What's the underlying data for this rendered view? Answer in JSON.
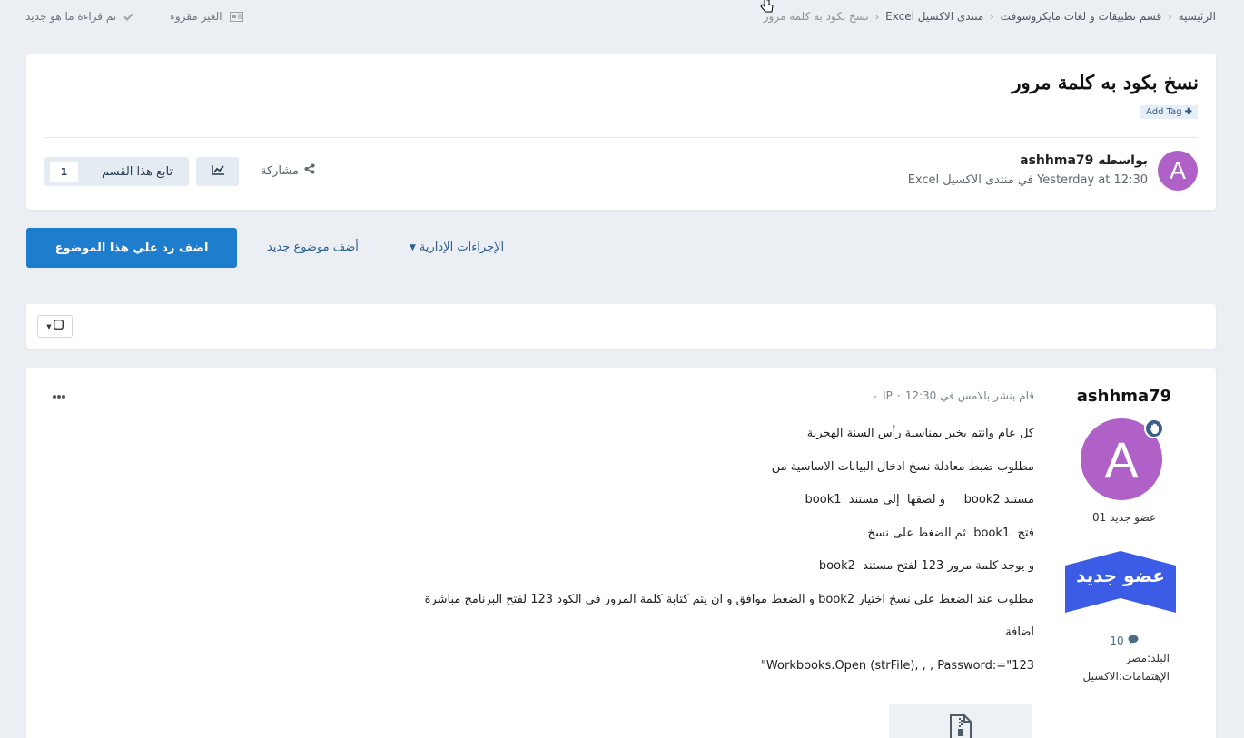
{
  "breadcrumb": {
    "items": [
      "الرئيسيه",
      "قسم تطبيقات و لغات مايكروسوفت",
      "منتدى الاكسيل Excel"
    ],
    "current": "نسخ بكود به كلمة مرور"
  },
  "top_actions": {
    "unread": "الغير مقروء",
    "mark_read": "تم قراءة ما هو جديد"
  },
  "topic": {
    "title": "نسخ بكود به كلمة مرور",
    "add_tag": "Add Tag",
    "author_line": "بواسطه ashhma79",
    "meta_line": "Yesterday at 12:30 في منتدى الاكسيل Excel",
    "avatar_letter": "A",
    "share_label": "مشاركة",
    "follow_label": "تابع هذا القسم",
    "follow_count": "1"
  },
  "actions": {
    "reply": "اضف رد علي هذا الموضوع",
    "new_topic": "أضف موضوع جديد",
    "moderation": "الإجراءات الإدارية"
  },
  "post": {
    "author": "ashhma79",
    "avatar_letter": "A",
    "rank_title": "عضو جديد 01",
    "rank_badge_text": "عضو جديد",
    "post_count": "10",
    "country": "البلد:مصر",
    "interests": "الإهتمامات:الاكسيل",
    "meta": "قام بنشر بالامس في 12:30",
    "ip_label": "IP",
    "body": [
      "كل عام وانتم بخير بمناسبة رأس السنة الهجرية",
      "مطلوب ضبط معادلة نسخ ادخال البيانات الاساسية من",
      "مستند book2     و لصقها  إلى مستند  book1",
      "فتح  book1  ثم الضغط على نسخ",
      "و يوجد كلمة مرور 123 لفتح مستند  book2",
      "مطلوب عند الضغط على نسخ اختيار book2 و الضغط موافق و ان يتم كتابة كلمة المرور فى الكود 123 لفتح البرنامج مباشرة",
      "اضافة",
      "\"Workbooks.Open (strFile), , , Password:=\"123"
    ]
  },
  "colors": {
    "accent": "#1f7dcd",
    "avatar": "#b061c7",
    "background": "#ebeef2",
    "rank_badge": "#3d5ce6"
  }
}
